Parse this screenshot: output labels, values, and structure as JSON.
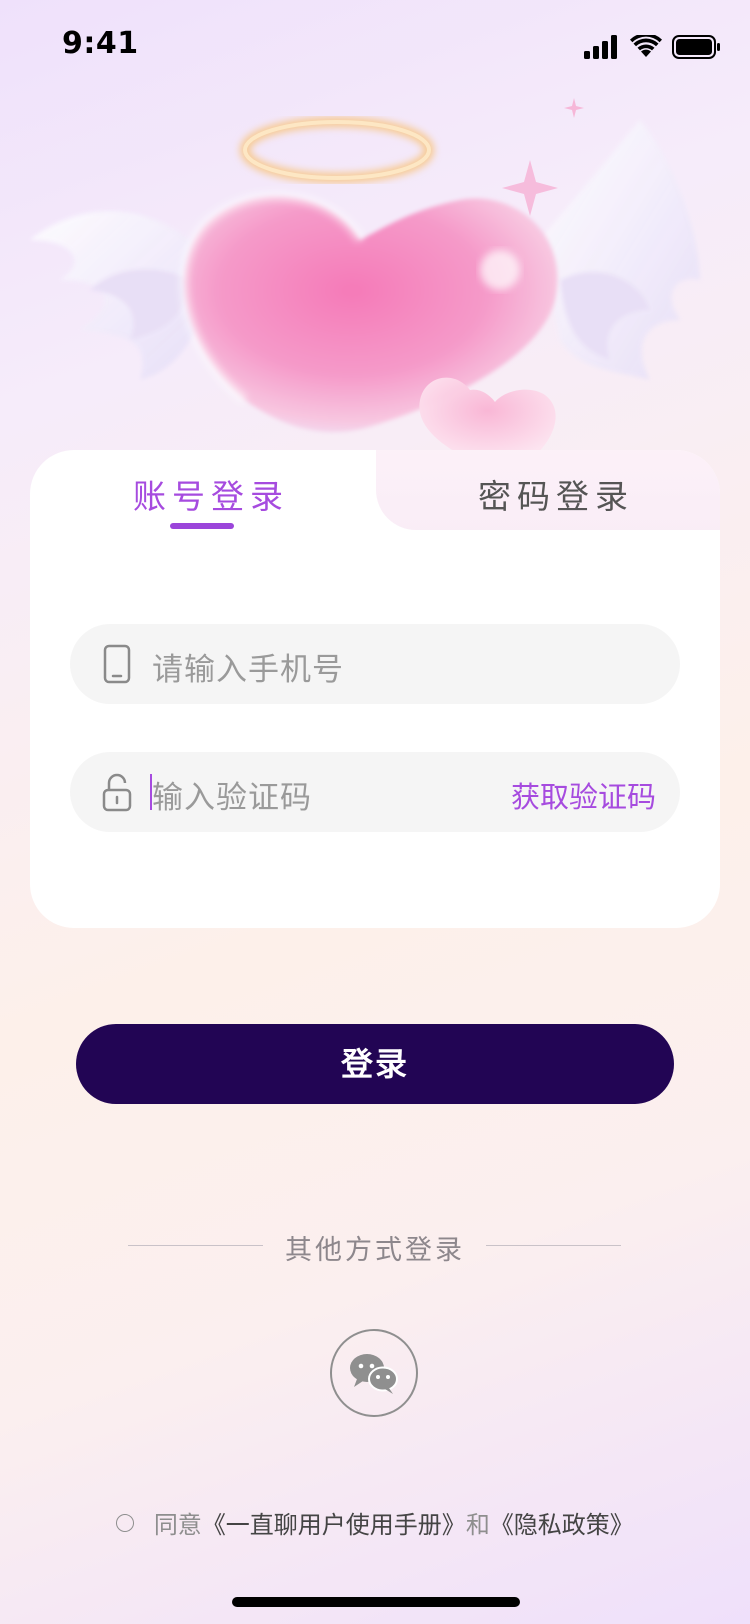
{
  "status_bar": {
    "time": "9:41"
  },
  "tabs": {
    "account_login": "账号登录",
    "password_login": "密码登录"
  },
  "phone_field": {
    "placeholder": "请输入手机号"
  },
  "code_field": {
    "placeholder": "输入验证码",
    "get_code_label": "获取验证码"
  },
  "login_button": {
    "label": "登录"
  },
  "other_methods": {
    "label": "其他方式登录"
  },
  "agreement": {
    "prefix": "同意",
    "user_manual": "《一直聊用户使用手册》",
    "and": "和",
    "privacy_policy": "《隐私政策》"
  },
  "colors": {
    "accent": "#a64bdf",
    "button_bg": "#220554",
    "field_bg": "#f5f5f5"
  },
  "icons": [
    "signal-icon",
    "wifi-icon",
    "battery-icon",
    "phone-icon",
    "lock-icon",
    "wechat-icon"
  ]
}
